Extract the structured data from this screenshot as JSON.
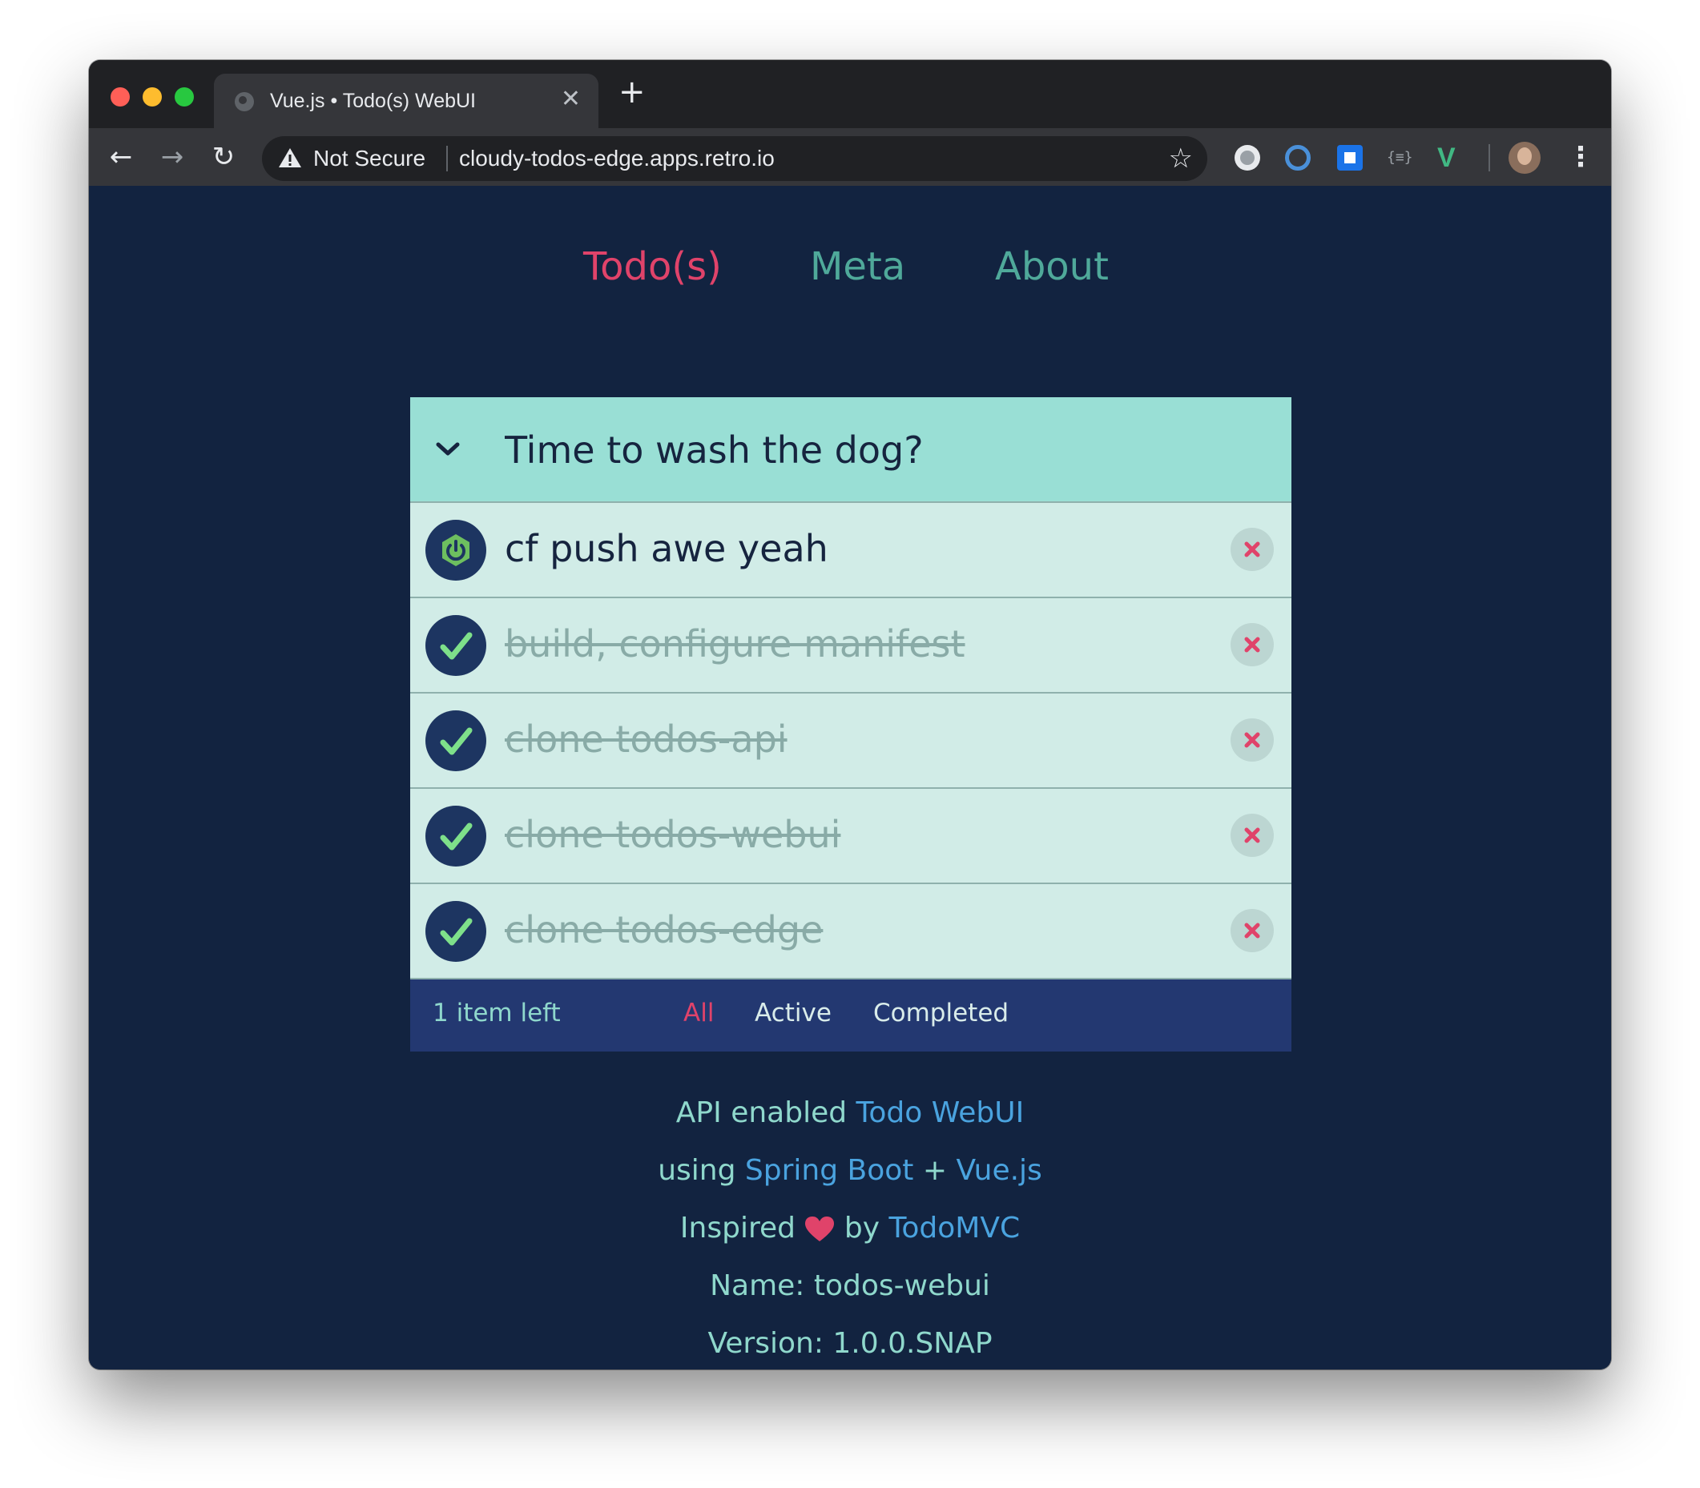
{
  "browser": {
    "tab_title": "Vue.js • Todo(s) WebUI",
    "tab_close": "✕",
    "new_tab": "+",
    "security_label": "Not Secure",
    "url": "cloudy-todos-edge.apps.retro.io",
    "ext4_label": "{≡}",
    "ext5_label": "V"
  },
  "nav": {
    "todos": "Todo(s)",
    "meta": "Meta",
    "about": "About"
  },
  "new_todo": {
    "value": "Time to wash the dog?"
  },
  "todos": [
    {
      "title": "cf push awe yeah",
      "completed": false
    },
    {
      "title": "build, configure manifest",
      "completed": true
    },
    {
      "title": "clone todos-api",
      "completed": true
    },
    {
      "title": "clone todos-webui",
      "completed": true
    },
    {
      "title": "clone todos-edge",
      "completed": true
    }
  ],
  "footer": {
    "items_left": "1 item left",
    "filters": {
      "all": "All",
      "active": "Active",
      "completed": "Completed"
    }
  },
  "info": {
    "line1_prefix": "API enabled",
    "line1_link": "Todo WebUI",
    "line2_prefix": "using",
    "line2_link1": "Spring Boot",
    "line2_plus": "+",
    "line2_link2": "Vue.js",
    "line3_prefix": "Inspired",
    "line3_by": "by",
    "line3_link": "TodoMVC",
    "name": "Name: todos-webui",
    "version": "Version: 1.0.0.SNAP"
  },
  "colors": {
    "page_bg": "#122340",
    "accent_pink": "#e0436a",
    "accent_teal": "#4fa99a",
    "link_blue": "#4aa3df"
  }
}
